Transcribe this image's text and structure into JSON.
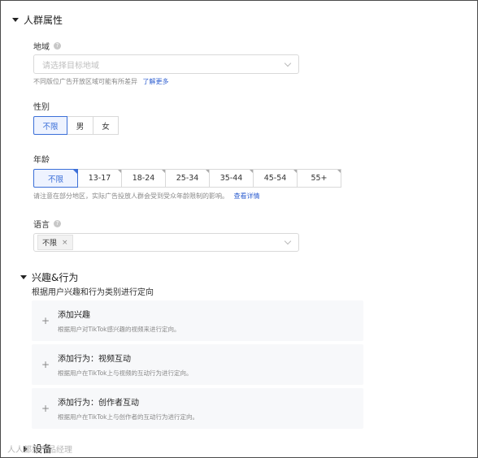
{
  "audience_section": {
    "title": "人群属性",
    "region": {
      "label": "地域",
      "placeholder": "请选择目标地域",
      "hint": "不同版位广告开放区域可能有所差异",
      "link": "了解更多"
    },
    "gender": {
      "label": "性别",
      "options": [
        "不限",
        "男",
        "女"
      ],
      "selected": "不限"
    },
    "age": {
      "label": "年龄",
      "options": [
        "不限",
        "13-17",
        "18-24",
        "25-34",
        "35-44",
        "45-54",
        "55+"
      ],
      "selected": "不限",
      "hint": "请注意在部分地区，实际广告投放人群会受到受众年龄限制的影响。",
      "link": "查看详情"
    },
    "language": {
      "label": "语言",
      "tag": "不限",
      "tag_remove": "×"
    }
  },
  "interest_section": {
    "title": "兴趣&行为",
    "subtitle": "根据用户兴趣和行为类别进行定向",
    "cards": [
      {
        "icon": "+",
        "title": "添加兴趣",
        "desc": "根据用户对TikTok感兴趣的视频来进行定向。"
      },
      {
        "icon": "+",
        "title": "添加行为：视频互动",
        "desc": "根据用户在TikTok上与视频的互动行为进行定向。"
      },
      {
        "icon": "+",
        "title": "添加行为：创作者互动",
        "desc": "根据用户在TikTok上与创作者的互动行为进行定向。"
      }
    ]
  },
  "device_section": {
    "title": "设备"
  },
  "watermark": {
    "text": "人人都是产品经理"
  },
  "colors": {
    "accent": "#3b6fd8",
    "link": "#2f5fd0",
    "card_bg": "#f7f8fa"
  }
}
